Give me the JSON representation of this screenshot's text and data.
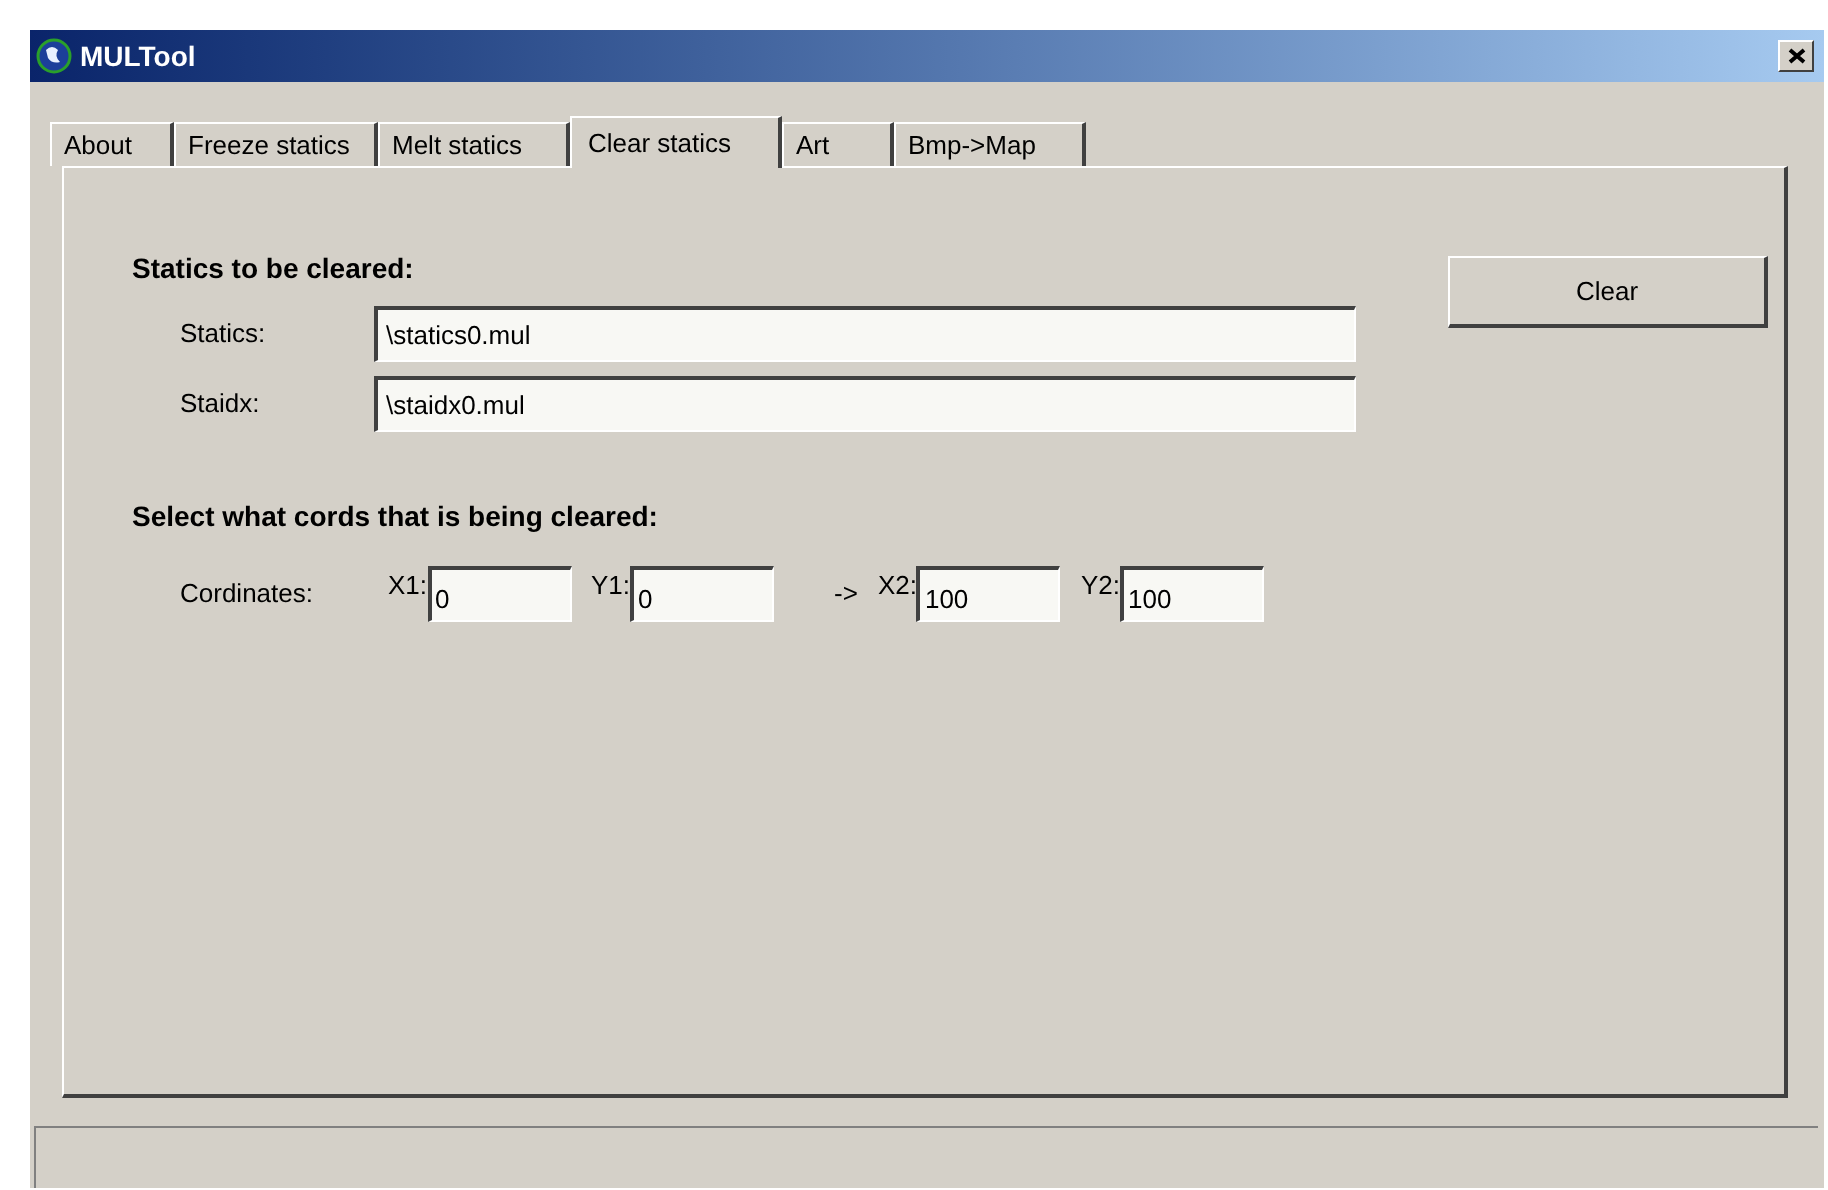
{
  "window": {
    "title": "MULTool"
  },
  "tabs": [
    {
      "label": "About",
      "selected": false
    },
    {
      "label": "Freeze statics",
      "selected": false
    },
    {
      "label": "Melt statics",
      "selected": false
    },
    {
      "label": "Clear statics",
      "selected": true
    },
    {
      "label": "Art",
      "selected": false
    },
    {
      "label": "Bmp->Map",
      "selected": false
    }
  ],
  "files": {
    "heading": "Statics to be cleared:",
    "fields": [
      {
        "label": "Statics:",
        "value": "\\statics0.mul"
      },
      {
        "label": "Staidx:",
        "value": "\\staidx0.mul"
      }
    ]
  },
  "coords": {
    "heading": "Select what cords that is being cleared:",
    "label": "Cordinates:",
    "arrow": "->",
    "fields": [
      {
        "label": "X1:",
        "value": "0"
      },
      {
        "label": "Y1:",
        "value": "0"
      },
      {
        "label": "X2:",
        "value": "100"
      },
      {
        "label": "Y2:",
        "value": "100"
      }
    ]
  },
  "clear_button": "Clear"
}
